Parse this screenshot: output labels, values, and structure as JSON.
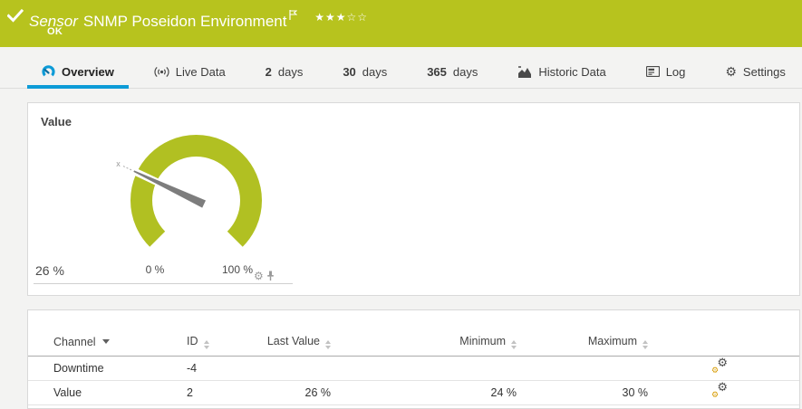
{
  "colors": {
    "status_green": "#b7c31e",
    "accent_blue": "#0d9bd7",
    "gauge_green": "#b1c022",
    "needle_gray": "#7d7d7d"
  },
  "topbar": {
    "kind": "Sensor",
    "name": "SNMP Poseidon Environment",
    "status": "OK",
    "stars": "★★★☆☆",
    "stars_filled": 3,
    "stars_total": 5
  },
  "tabs": {
    "overview": {
      "label": "Overview"
    },
    "live_data": {
      "label": "Live Data"
    },
    "days2": {
      "num": "2",
      "label": "days"
    },
    "days30": {
      "num": "30",
      "label": "days"
    },
    "days365": {
      "num": "365",
      "label": "days"
    },
    "historic": {
      "label": "Historic Data"
    },
    "log": {
      "label": "Log"
    },
    "settings": {
      "label": "Settings"
    }
  },
  "gauge_panel": {
    "title": "Value",
    "current_value": "26 %",
    "scale_min": "0 %",
    "scale_max": "100 %",
    "marker_label": "x",
    "value_percent": 26,
    "scale_start_percent": 0,
    "scale_end_percent": 100
  },
  "channel_table": {
    "headers": {
      "channel": "Channel",
      "id": "ID",
      "last_value": "Last Value",
      "minimum": "Minimum",
      "maximum": "Maximum"
    },
    "sort": {
      "active_column": "Channel",
      "direction": "desc"
    },
    "rows": [
      {
        "channel": "Downtime",
        "id": "-4",
        "last_value": "",
        "minimum": "",
        "maximum": ""
      },
      {
        "channel": "Value",
        "id": "2",
        "last_value": "26 %",
        "minimum": "24 %",
        "maximum": "30 %"
      }
    ]
  }
}
